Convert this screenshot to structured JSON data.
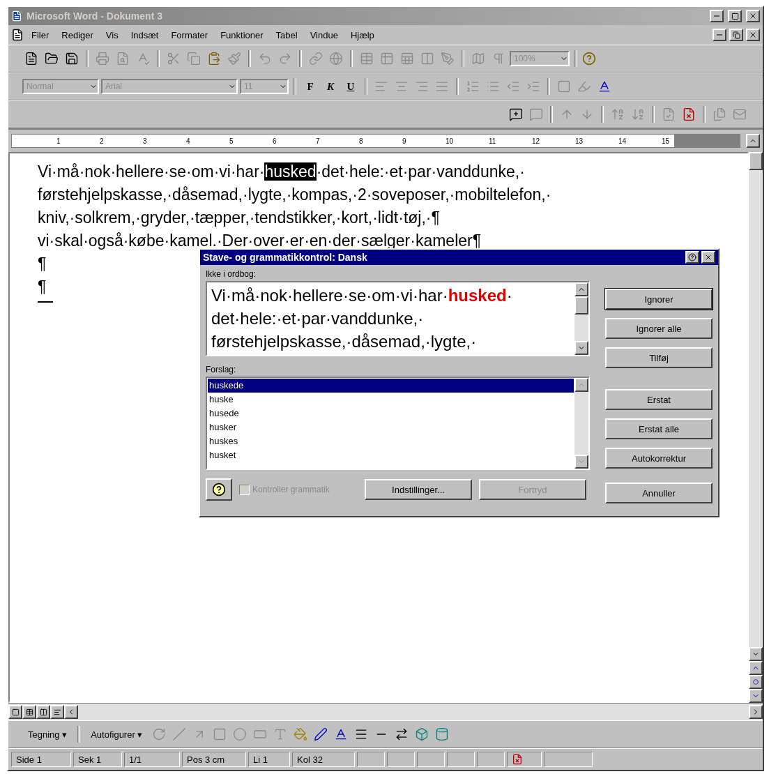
{
  "window": {
    "title": "Microsoft Word - Dokument 3",
    "active": false
  },
  "menu": [
    "Filer",
    "Rediger",
    "Vis",
    "Indsæt",
    "Formater",
    "Funktioner",
    "Tabel",
    "Vindue",
    "Hjælp"
  ],
  "standard_toolbar": {
    "buttons": [
      {
        "kind": "new",
        "disabled": false
      },
      {
        "kind": "open",
        "disabled": false
      },
      {
        "kind": "save",
        "disabled": false
      },
      {
        "kind": "sep"
      },
      {
        "kind": "print",
        "disabled": true
      },
      {
        "kind": "preview",
        "disabled": true
      },
      {
        "kind": "spell",
        "disabled": true
      },
      {
        "kind": "sep"
      },
      {
        "kind": "cut",
        "disabled": true
      },
      {
        "kind": "copy",
        "disabled": true
      },
      {
        "kind": "paste",
        "disabled": false
      },
      {
        "kind": "painter",
        "disabled": true
      },
      {
        "kind": "sep"
      },
      {
        "kind": "undo",
        "disabled": true
      },
      {
        "kind": "redo",
        "disabled": true
      },
      {
        "kind": "sep"
      },
      {
        "kind": "link",
        "disabled": true
      },
      {
        "kind": "web",
        "disabled": true
      },
      {
        "kind": "sep"
      },
      {
        "kind": "table",
        "disabled": true
      },
      {
        "kind": "grid",
        "disabled": true
      },
      {
        "kind": "sheet",
        "disabled": true
      },
      {
        "kind": "columns",
        "disabled": true
      },
      {
        "kind": "drawing",
        "disabled": true
      },
      {
        "kind": "sep"
      },
      {
        "kind": "map",
        "disabled": true
      },
      {
        "kind": "pilcrow",
        "disabled": true
      }
    ],
    "zoom": "100%",
    "zoom_disabled": true
  },
  "formatting_toolbar": {
    "style": "Normal",
    "font": "Arial",
    "size": "11",
    "disabled": true,
    "styles": [
      {
        "label": "F",
        "kind": "bold"
      },
      {
        "label": "K",
        "kind": "italic"
      },
      {
        "label": "U",
        "kind": "underline"
      }
    ],
    "buttons": [
      {
        "kind": "align-left",
        "disabled": true
      },
      {
        "kind": "align-center",
        "disabled": true
      },
      {
        "kind": "align-right",
        "disabled": true
      },
      {
        "kind": "justify",
        "disabled": true
      },
      {
        "kind": "sep"
      },
      {
        "kind": "numbering",
        "disabled": true
      },
      {
        "kind": "bullets",
        "disabled": true
      },
      {
        "kind": "outdent",
        "disabled": true
      },
      {
        "kind": "indent",
        "disabled": true
      },
      {
        "kind": "sep"
      },
      {
        "kind": "border",
        "disabled": true
      },
      {
        "kind": "highlight",
        "disabled": true
      },
      {
        "kind": "font-color",
        "disabled": false
      }
    ]
  },
  "review_toolbar": {
    "buttons": [
      {
        "kind": "comment",
        "disabled": false
      },
      {
        "kind": "edit-comment",
        "disabled": true
      },
      {
        "kind": "sep"
      },
      {
        "kind": "prev",
        "disabled": true
      },
      {
        "kind": "next",
        "disabled": true
      },
      {
        "kind": "sep"
      },
      {
        "kind": "sort-up",
        "disabled": true
      },
      {
        "kind": "sort-down",
        "disabled": true
      },
      {
        "kind": "sep"
      },
      {
        "kind": "track",
        "disabled": true
      },
      {
        "kind": "accept",
        "disabled": false
      },
      {
        "kind": "sep"
      },
      {
        "kind": "versions",
        "disabled": true
      },
      {
        "kind": "mail",
        "disabled": true
      }
    ]
  },
  "ruler": {
    "marks": [
      "1",
      "2",
      "3",
      "4",
      "5",
      "6",
      "7",
      "8",
      "9",
      "10",
      "11",
      "12",
      "13",
      "14",
      "15"
    ]
  },
  "document": {
    "lines": [
      {
        "segments": [
          {
            "text": "Vi·må·nok·hellere·se·om·vi·har·",
            "selected": false
          },
          {
            "text": "husked",
            "selected": true
          },
          {
            "text": "·det·hele:·et·par·vanddunke,·",
            "selected": false
          }
        ]
      },
      {
        "segments": [
          {
            "text": "førstehjelpskasse,·dåsemad,·lygte,·kompas,·2·soveposer,·mobiltelefon,·",
            "selected": false
          }
        ]
      },
      {
        "segments": [
          {
            "text": "kniv,·solkrem,·gryder,·tæpper,·tendstikker,·kort,·lidt·tøj,·¶",
            "selected": false
          }
        ]
      },
      {
        "segments": [
          {
            "text": "vi·skal·også·købe·kamel.·Der·over·er·en·der·sælger·kameler¶",
            "selected": false
          }
        ]
      },
      {
        "segments": [
          {
            "text": "¶",
            "selected": false
          }
        ]
      },
      {
        "segments": [
          {
            "text": "¶",
            "selected": false
          }
        ]
      }
    ]
  },
  "dialog": {
    "title": "Stave- og grammatikkontrol: Dansk",
    "not_in_dictionary_label": "Ikke i ordbog:",
    "sentence": {
      "before": "Vi·må·nok·hellere·se·om·vi·har·",
      "error": "husked",
      "after": "·\ndet·hele:·et·par·vanddunke,·\nførstehjelpskasse,·dåsemad,·lygte,·"
    },
    "suggestions_label": "Forslag:",
    "suggestions": [
      {
        "text": "huskede",
        "selected": true
      },
      {
        "text": "huske",
        "selected": false
      },
      {
        "text": "husede",
        "selected": false
      },
      {
        "text": "husker",
        "selected": false
      },
      {
        "text": "huskes",
        "selected": false
      },
      {
        "text": "husket",
        "selected": false
      }
    ],
    "side_buttons": [
      {
        "label": "Ignorer",
        "disabled": false,
        "default": true
      },
      {
        "label": "Ignorer alle",
        "disabled": false,
        "default": false
      },
      {
        "label": "Tilføj",
        "disabled": false,
        "default": false
      },
      {
        "label": "Erstat",
        "disabled": false,
        "default": false
      },
      {
        "label": "Erstat alle",
        "disabled": false,
        "default": false
      },
      {
        "label": "Autokorrektur",
        "disabled": false,
        "default": false
      },
      {
        "label": "Annuller",
        "disabled": false,
        "default": false
      }
    ],
    "check_grammar": {
      "label": "Kontroller grammatik",
      "checked": false,
      "disabled": true
    },
    "bottom_buttons": [
      {
        "label": "Indstillinger...",
        "disabled": false
      },
      {
        "label": "Fortryd",
        "disabled": true
      }
    ]
  },
  "drawing_toolbar": {
    "menus": [
      {
        "label": "Tegning",
        "caret": "▾"
      },
      {
        "label": "Autofigurer",
        "caret": "▾"
      }
    ],
    "buttons": [
      {
        "kind": "rotate",
        "disabled": true
      },
      {
        "kind": "line",
        "disabled": true
      },
      {
        "kind": "arrow",
        "disabled": true
      },
      {
        "kind": "rect",
        "disabled": true
      },
      {
        "kind": "ellipse",
        "disabled": true
      },
      {
        "kind": "textbox",
        "disabled": true
      },
      {
        "kind": "wordart",
        "disabled": true
      },
      {
        "kind": "fill",
        "disabled": false
      },
      {
        "kind": "pen",
        "disabled": false
      },
      {
        "kind": "font-color",
        "disabled": false
      },
      {
        "kind": "line-style",
        "disabled": false
      },
      {
        "kind": "dash",
        "disabled": false
      },
      {
        "kind": "arrows",
        "disabled": false
      },
      {
        "kind": "shadow",
        "disabled": false
      },
      {
        "kind": "extrusion",
        "disabled": false
      }
    ]
  },
  "status_bar": [
    "Side 1",
    "Sek 1",
    "1/1",
    "Pos 3 cm",
    "Li 1",
    "Kol 32"
  ]
}
